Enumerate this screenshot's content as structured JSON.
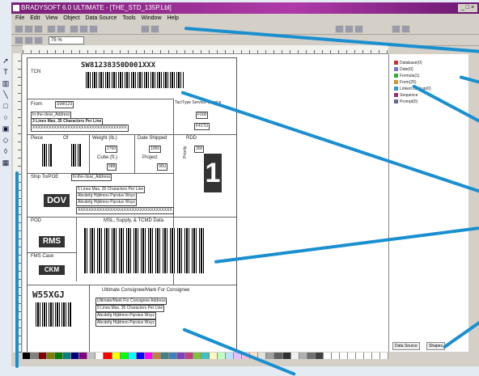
{
  "window": {
    "title": "BRADYSOFT 6.0 ULTIMATE - [THE_STD_135P.Lbl]",
    "controls": "_ □ ×"
  },
  "menu": [
    "File",
    "Edit",
    "View",
    "Object",
    "Data Source",
    "Tools",
    "Window",
    "Help"
  ],
  "toolbar": {
    "zoom_value": "75 %"
  },
  "label": {
    "tcn_caption": "TCN",
    "tcn_value": "SW81238350D001XXX",
    "from_caption": "From",
    "from_value": "SW8123",
    "from_address": "In-the-clear_Address",
    "from_lines": "3 Lines Max, 35 Characters Per Line",
    "from_x": "XXXXXXXXXXXXXXXXXXXXXXXXXXXXXXXXXXX",
    "tac_caption": "Tac/Type Service/ Service",
    "tac_value1": "F000",
    "tac_value2": "F41TU",
    "piece_caption": "Piece",
    "of_caption": "Of",
    "weight_caption": "Weight (lb.)",
    "weight_value": "2760",
    "date_shipped_caption": "Date Shipped",
    "date_shipped_value": "1050",
    "rdd_caption": "RDD",
    "rdd_value": "300",
    "cube_caption": "Cube (ft.)",
    "cube_value": "588",
    "project_caption": "Project",
    "project_value": "90U",
    "priority_caption": "Priority",
    "priority_value": "1",
    "shipto_caption": "Ship To/POE",
    "shipto_address": "In-the-clear_Address",
    "shipto_code": "DOV",
    "shipto_lines": "5 Lines Max, 35 Characters Per Line",
    "shipto_l2": "Abcdefg Hijklmno Pqrstuv Wxyz",
    "shipto_l3": "Abcdefg Hijklmno Pqrstuv Wxyz",
    "shipto_x": "XXXXXXXXXXXXXXXXXXXXXXXXXXXXXXXXXXX",
    "pod_caption": "POD",
    "pod_code": "RMS",
    "msl_caption": "MSL, Supply, & TCMD Data",
    "fms_caption": "FMS Case",
    "fms_code": "CKM",
    "consignee_code": "W55XGJ",
    "consignee_caption": "Ultimate Consignee/Mark For Consignee",
    "consignee_l1": "Ultimate/Mark For Consignee Address",
    "consignee_l2": "5 Lines Max, 35 Characters Per Line",
    "consignee_l3": "Abcdefg Hijklmno Pqrstuv Wxyz",
    "consignee_l4": "Abcdefg Hijklmno Pqrstuv Wxyz"
  },
  "panel": {
    "tree": [
      "Database(0)",
      "Date(0)",
      "Formula(1)",
      "Form(25)",
      "Linked Lookup(0)",
      "Sequence",
      "Prompt(0)"
    ],
    "tabs": [
      "Data Source",
      "Shapes"
    ]
  },
  "colors": {
    "callout": "#1a8fd0",
    "titlebar": "#9a2a92"
  }
}
